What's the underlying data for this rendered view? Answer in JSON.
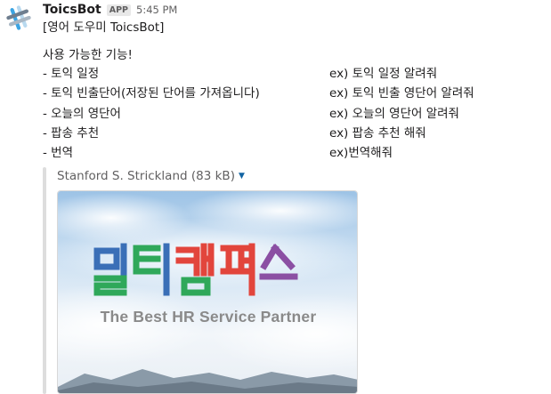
{
  "message": {
    "bot_name": "ToicsBot",
    "badge": "APP",
    "time": "5:45 PM",
    "avatar_icon": "slack-hash-logo-icon",
    "lines": {
      "title": "[영어 도우미 ToicsBot]",
      "features_heading": "사용 가능한 기능!"
    },
    "features": [
      {
        "name": "- 토익 일정",
        "example": "ex) 토익 일정 알려줘"
      },
      {
        "name": "- 토익 빈출단어(저장된 단어를 가져옵니다)",
        "example": "ex) 토익 빈출 영단어 알려줘"
      },
      {
        "name": "- 오늘의 영단어",
        "example": "ex) 오늘의 영단어 알려줘"
      },
      {
        "name": "- 팝송 추천",
        "example": "ex) 팝송 추천 해줘"
      },
      {
        "name": "- 번역",
        "example": "ex)번역해줘"
      }
    ]
  },
  "attachment": {
    "title": "Stanford S. Strickland (83 kB)",
    "caret_icon": "caret-down-icon",
    "image": {
      "logo_text": "멀티캠퍼스",
      "tagline": "The Best HR Service Partner",
      "colors": {
        "blue": "#3a6fb7",
        "green": "#2fa85a",
        "red": "#e2453c",
        "purple": "#8b4fa3",
        "sky": "#b9d4ec"
      }
    }
  }
}
